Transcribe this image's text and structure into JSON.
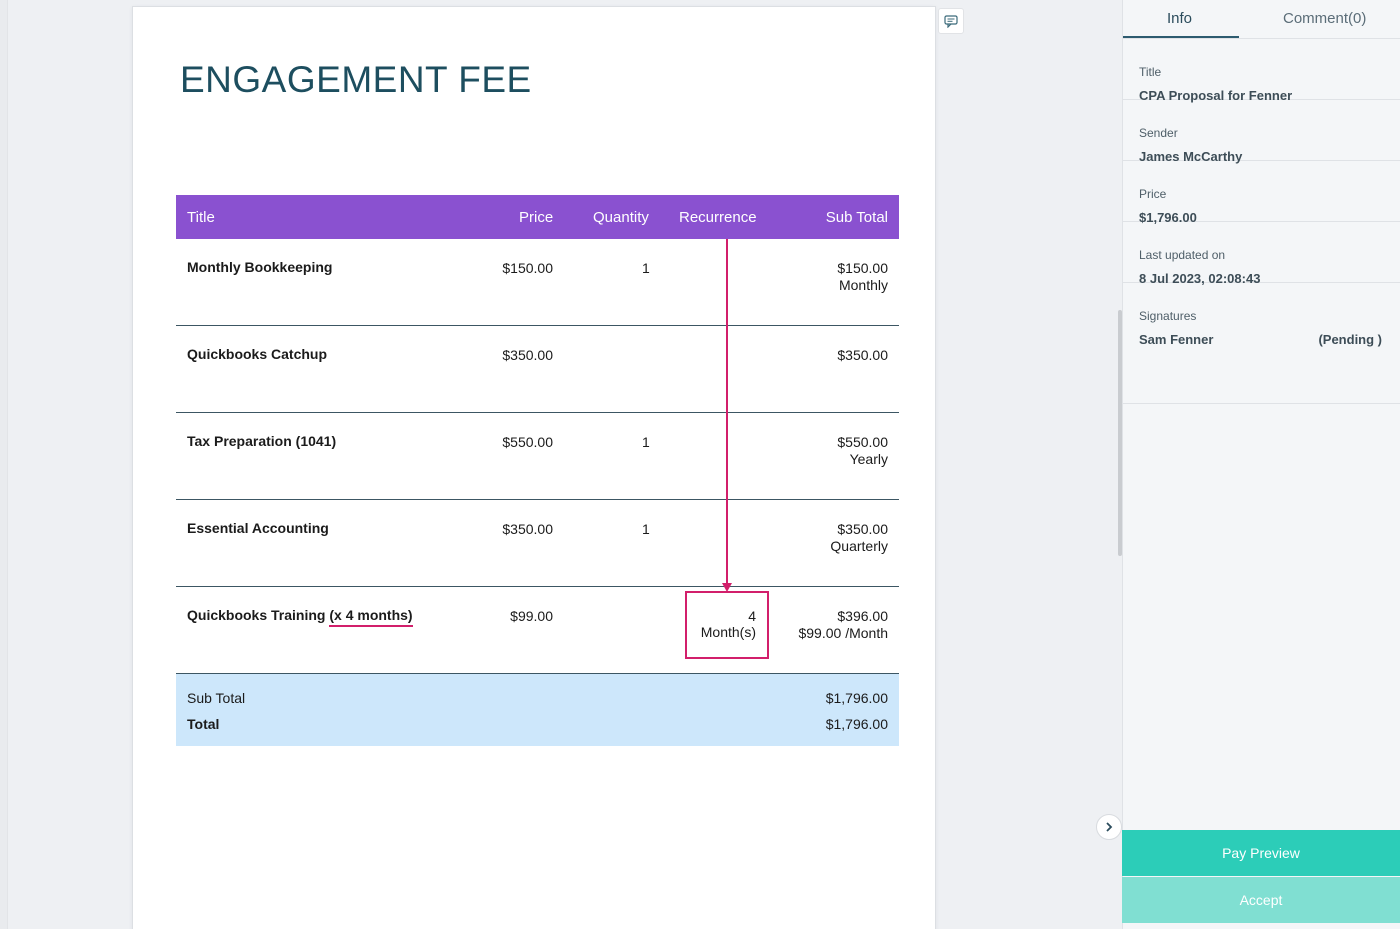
{
  "document": {
    "heading": "ENGAGEMENT FEE",
    "table": {
      "columns": [
        "Title",
        "Price",
        "Quantity",
        "Recurrence",
        "Sub Total"
      ],
      "rows": [
        {
          "title": "Monthly Bookkeeping",
          "price": "$150.00",
          "quantity": "1",
          "recurrence": "",
          "subtotal": "$150.00",
          "subtotal_note": "Monthly"
        },
        {
          "title": "Quickbooks Catchup",
          "price": "$350.00",
          "quantity": "",
          "recurrence": "",
          "subtotal": "$350.00",
          "subtotal_note": ""
        },
        {
          "title": "Tax Preparation (1041)",
          "price": "$550.00",
          "quantity": "1",
          "recurrence": "",
          "subtotal": "$550.00",
          "subtotal_note": "Yearly"
        },
        {
          "title": "Essential Accounting",
          "price": "$350.00",
          "quantity": "1",
          "recurrence": "",
          "subtotal": "$350.00",
          "subtotal_note": "Quarterly"
        },
        {
          "title_main": "Quickbooks Training ",
          "title_highlight": "(x 4 months)",
          "price": "$99.00",
          "quantity": "",
          "recurrence_count": "4",
          "recurrence_unit": "Month(s)",
          "subtotal": "$396.00",
          "subtotal_note": "$99.00 /Month"
        }
      ],
      "totals": {
        "subtotal_label": "Sub Total",
        "subtotal_value": "$1,796.00",
        "total_label": "Total",
        "total_value": "$1,796.00"
      }
    }
  },
  "sidebar": {
    "tabs": {
      "info": "Info",
      "comment": "Comment(0)"
    },
    "fields": {
      "title_label": "Title",
      "title_value": "CPA Proposal for Fenner",
      "sender_label": "Sender",
      "sender_value": "James McCarthy",
      "price_label": "Price",
      "price_value": "$1,796.00",
      "updated_label": "Last updated on",
      "updated_value": "8 Jul 2023, 02:08:43",
      "signatures_label": "Signatures",
      "signer_name": "Sam Fenner",
      "signer_status": "(Pending )"
    },
    "buttons": {
      "pay_preview": "Pay Preview",
      "accept": "Accept"
    }
  },
  "icons": {
    "comment": "comment-icon",
    "collapse": "chevron-right-icon"
  },
  "colors": {
    "table_header": "#8a51d0",
    "accent_annotation": "#d21f6b",
    "totals_bg": "#cde7fb",
    "heading": "#1d4e5f",
    "primary_button": "#2ccdb8",
    "secondary_button": "#80dfd2"
  }
}
